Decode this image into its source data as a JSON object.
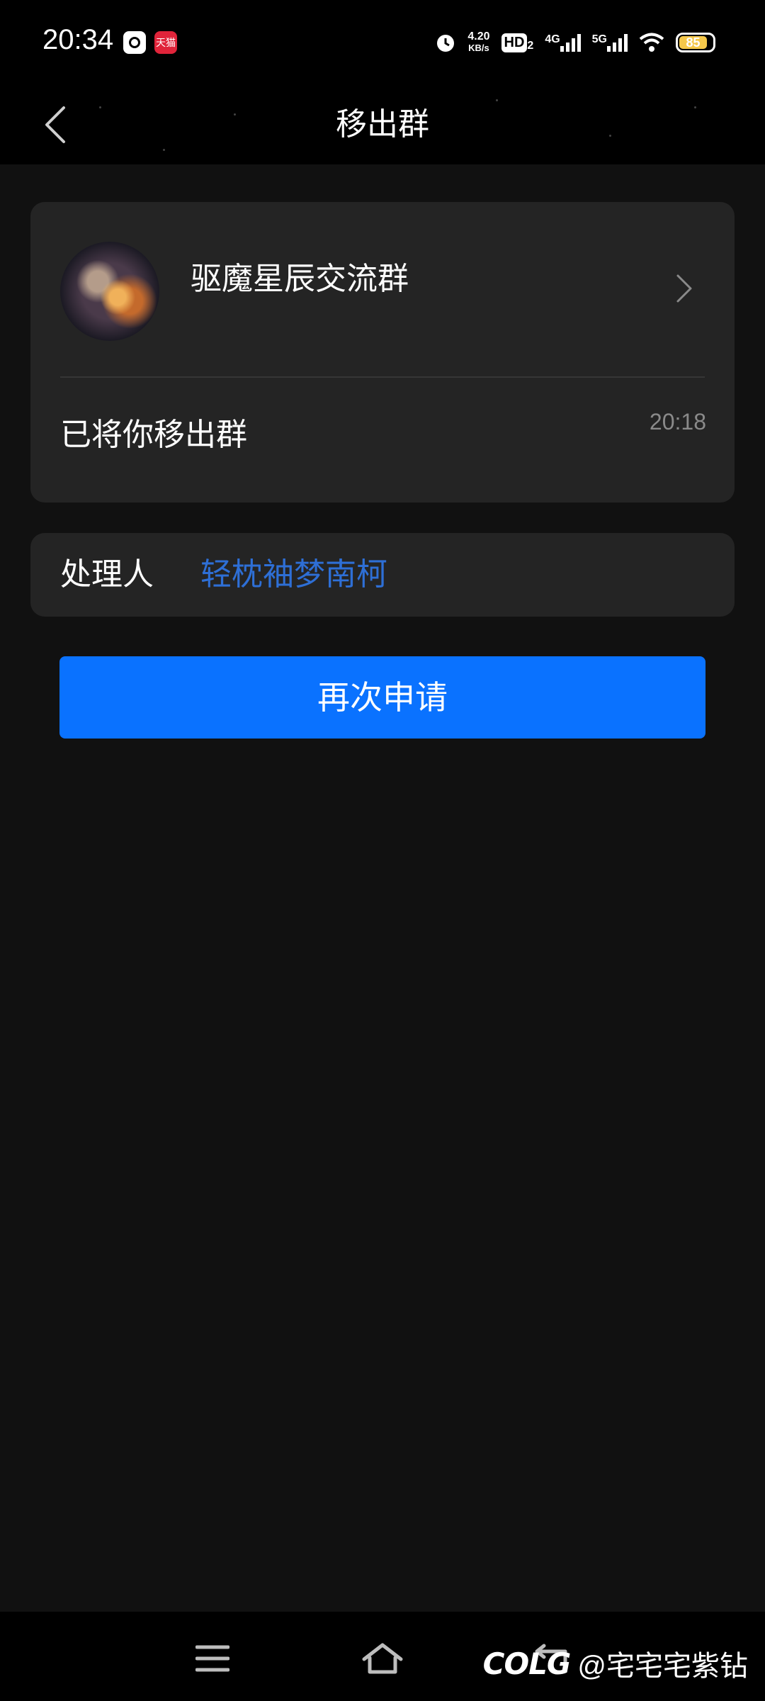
{
  "status_bar": {
    "time": "20:34",
    "net_speed_value": "4.20",
    "net_speed_unit": "KB/s",
    "hd_label": "HD",
    "hd_sub": "2",
    "sig1_label": "4G",
    "sig2_label": "5G",
    "battery": "85",
    "app2_label": "天猫",
    "icons": [
      "alarm-icon",
      "wifi-icon"
    ]
  },
  "header": {
    "title": "移出群"
  },
  "group": {
    "name": "驱魔星辰交流群",
    "message": "已将你移出群",
    "time": "20:18"
  },
  "handler": {
    "label": "处理人",
    "name": "轻枕袖梦南柯"
  },
  "actions": {
    "reapply_label": "再次申请"
  },
  "watermark": {
    "logo": "COLG",
    "handle": "@宅宅宅紫钻"
  },
  "colors": {
    "background": "#111111",
    "card": "#242424",
    "accent": "#0a72ff",
    "link": "#2e6fd6"
  }
}
